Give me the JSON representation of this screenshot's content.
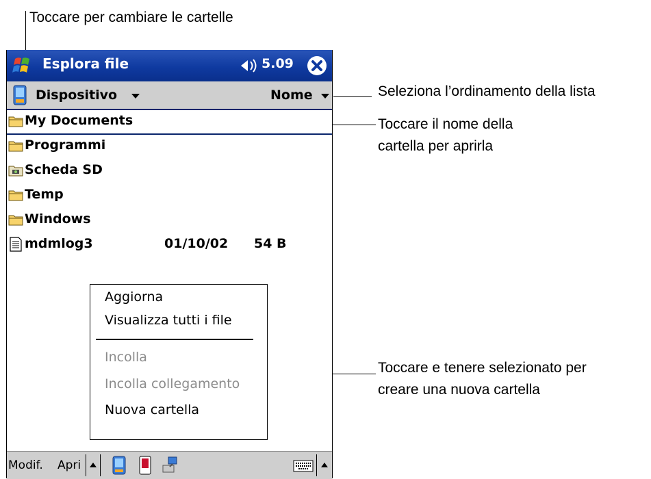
{
  "callouts": {
    "folders_tip": "Toccare per cambiare le cartelle",
    "sort_tip": "Seleziona l’ordinamento della lista",
    "open_tip_line1": "Toccare il nome della",
    "open_tip_line2": "cartella per aprirla",
    "new_tip_line1": "Toccare e tenere selezionato per",
    "new_tip_line2": "creare una nuova cartella"
  },
  "titlebar": {
    "title": "Esplora file",
    "clock": "5.09",
    "start_icon": "windows-flag-icon",
    "speaker_icon": "speaker-icon",
    "close_icon": "close-icon",
    "color": "#0f3aa0"
  },
  "navbar": {
    "location": "Dispositivo",
    "sort": "Nome"
  },
  "files": [
    {
      "name": "My Documents",
      "icon": "folder-icon"
    },
    {
      "name": "Programmi",
      "icon": "folder-icon"
    },
    {
      "name": "Scheda SD",
      "icon": "storage-card-icon"
    },
    {
      "name": "Temp",
      "icon": "folder-icon"
    },
    {
      "name": "Windows",
      "icon": "folder-icon"
    },
    {
      "name": "mdmlog3",
      "icon": "document-icon",
      "date": "01/10/02",
      "size": "54 B"
    }
  ],
  "context_menu": {
    "items": [
      "Aggiorna",
      "Visualizza tutti i file",
      "Incolla",
      "Incolla collegamento",
      "Nuova cartella"
    ],
    "disabled": [
      "Incolla",
      "Incolla collegamento"
    ]
  },
  "cmdbar": {
    "edit": "Modif.",
    "open": "Apri"
  },
  "colors": {
    "title_bg": "#0f3aa0",
    "bar_bg": "#cfcfcf",
    "selection_line": "#08246b",
    "disabled_text": "#8c8c8c"
  }
}
